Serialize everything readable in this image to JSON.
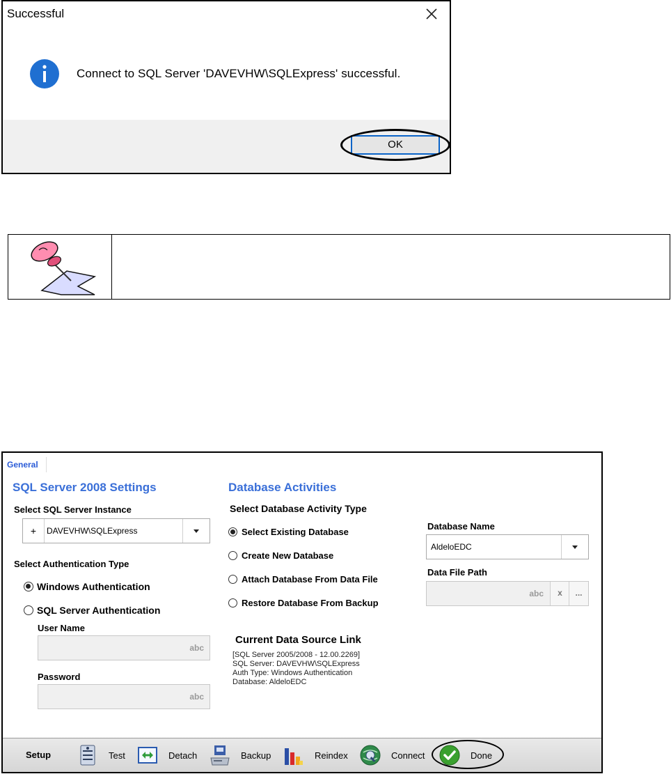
{
  "dialog": {
    "title": "Successful",
    "message": "Connect to SQL Server 'DAVEVHW\\SQLExpress' successful.",
    "ok_label": "OK"
  },
  "note": {
    "text": ""
  },
  "settings": {
    "tab_general": "General",
    "sql": {
      "title": "SQL Server 2008 Settings",
      "instance_label": "Select SQL Server Instance",
      "instance_add": "+",
      "instance_value": "DAVEVHW\\SQLExpress",
      "auth_label": "Select Authentication Type",
      "auth_windows": "Windows Authentication",
      "auth_sql": "SQL Server Authentication",
      "selected_auth": "Windows Authentication",
      "username_label": "User Name",
      "username_placeholder": "abc",
      "password_label": "Password",
      "password_placeholder": "abc"
    },
    "db": {
      "title": "Database Activities",
      "activity_label": "Select Database Activity Type",
      "opt_existing": "Select Existing Database",
      "opt_new": "Create New Database",
      "opt_attach": "Attach Database From Data File",
      "opt_restore": "Restore Database From Backup",
      "selected_activity": "Select Existing Database",
      "dbname_label": "Database Name",
      "dbname_value": "AldeloEDC",
      "datafile_label": "Data File Path",
      "datafile_placeholder": "abc",
      "clear_label": "x",
      "browse_label": "..."
    },
    "datasource": {
      "title": "Current Data Source Link",
      "lines": [
        "[SQL Server 2005/2008 - 12.00.2269]",
        "SQL Server: DAVEVHW\\SQLExpress",
        "Auth Type: Windows Authentication",
        "Database: AldeloEDC"
      ]
    },
    "toolbar": {
      "setup": "Setup",
      "test": "Test",
      "detach": "Detach",
      "backup": "Backup",
      "reindex": "Reindex",
      "connect": "Connect",
      "done": "Done"
    }
  },
  "colors": {
    "section_title": "#3a6fd8",
    "info_icon": "#1f6fd1",
    "ok_border": "#0a64c8",
    "done_check": "#3aa02f"
  }
}
